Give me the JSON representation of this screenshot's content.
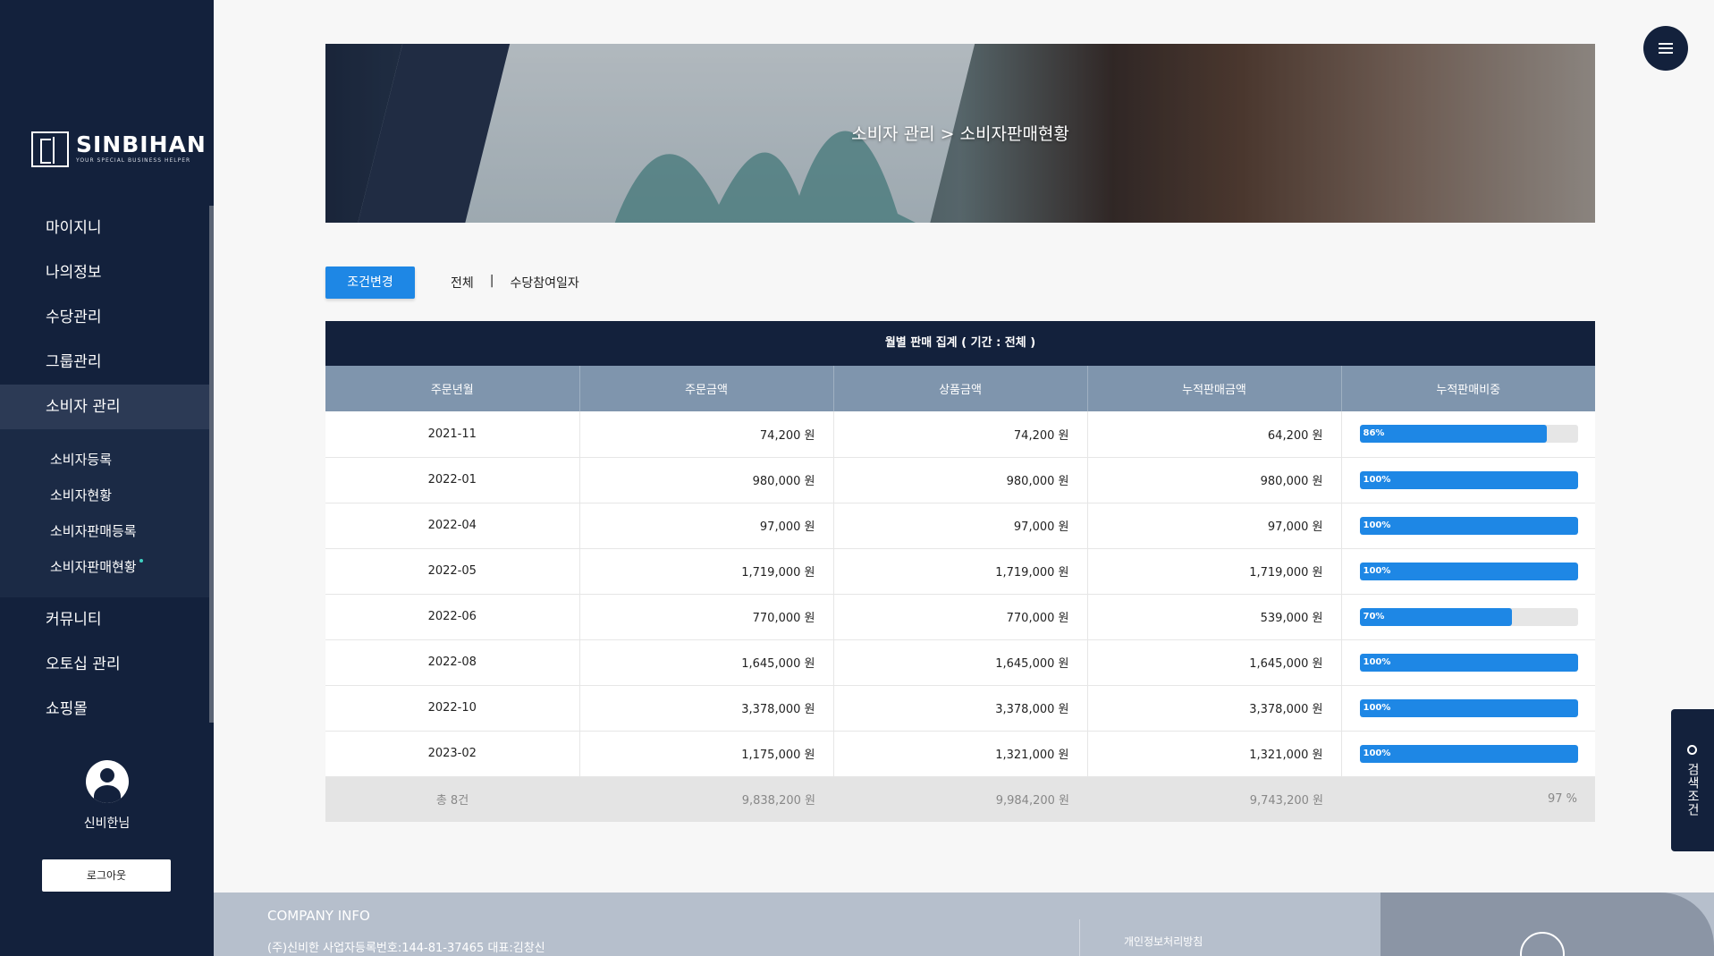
{
  "brand": {
    "name": "SINBIHAN",
    "tagline": "YOUR SPECIAL BUSINESS HELPER"
  },
  "sidebar": {
    "items": [
      {
        "label": "마이지니"
      },
      {
        "label": "나의정보"
      },
      {
        "label": "수당관리"
      },
      {
        "label": "그룹관리"
      },
      {
        "label": "소비자 관리"
      },
      {
        "label": "커뮤니티"
      },
      {
        "label": "오토십 관리"
      },
      {
        "label": "쇼핑몰"
      }
    ],
    "submenu": [
      {
        "label": "소비자등록"
      },
      {
        "label": "소비자현황"
      },
      {
        "label": "소비자판매등록"
      },
      {
        "label": "소비자판매현황"
      }
    ],
    "user_name": "신비한님",
    "logout_label": "로그아웃"
  },
  "banner": {
    "breadcrumb": "소비자 관리  >  소비자판매현황"
  },
  "filter": {
    "button_label": "조건변경",
    "range": "전체",
    "separator": "|",
    "type": "수당참여일자"
  },
  "table": {
    "title": "월별 판매 집계 ( 기간 : 전체 )",
    "headers": [
      "주문년월",
      "주문금액",
      "상품금액",
      "누적판매금액",
      "누적판매비중"
    ],
    "rows": [
      {
        "month": "2021-11",
        "order": "74,200 원",
        "product": "74,200 원",
        "cumulative": "64,200 원",
        "ratio_label": "86%",
        "ratio": 86
      },
      {
        "month": "2022-01",
        "order": "980,000 원",
        "product": "980,000 원",
        "cumulative": "980,000 원",
        "ratio_label": "100%",
        "ratio": 100
      },
      {
        "month": "2022-04",
        "order": "97,000 원",
        "product": "97,000 원",
        "cumulative": "97,000 원",
        "ratio_label": "100%",
        "ratio": 100
      },
      {
        "month": "2022-05",
        "order": "1,719,000 원",
        "product": "1,719,000 원",
        "cumulative": "1,719,000 원",
        "ratio_label": "100%",
        "ratio": 100
      },
      {
        "month": "2022-06",
        "order": "770,000 원",
        "product": "770,000 원",
        "cumulative": "539,000 원",
        "ratio_label": "70%",
        "ratio": 70
      },
      {
        "month": "2022-08",
        "order": "1,645,000 원",
        "product": "1,645,000 원",
        "cumulative": "1,645,000 원",
        "ratio_label": "100%",
        "ratio": 100
      },
      {
        "month": "2022-10",
        "order": "3,378,000 원",
        "product": "3,378,000 원",
        "cumulative": "3,378,000 원",
        "ratio_label": "100%",
        "ratio": 100
      },
      {
        "month": "2023-02",
        "order": "1,175,000 원",
        "product": "1,321,000 원",
        "cumulative": "1,321,000 원",
        "ratio_label": "100%",
        "ratio": 100
      }
    ],
    "total": {
      "count": "총 8건",
      "order": "9,838,200 원",
      "product": "9,984,200 원",
      "cumulative": "9,743,200 원",
      "ratio": "97 %"
    }
  },
  "side_tab": {
    "label": "검색조건",
    "icon": "search-icon"
  },
  "footer": {
    "title": "COMPANY INFO",
    "info": "(주)신비한    사업자등록번호:144-81-37465    대표:김창신",
    "policy": "개인정보처리방침"
  },
  "colors": {
    "navy": "#13213c",
    "accent": "#1e87e5",
    "header": "#7f95ad"
  }
}
